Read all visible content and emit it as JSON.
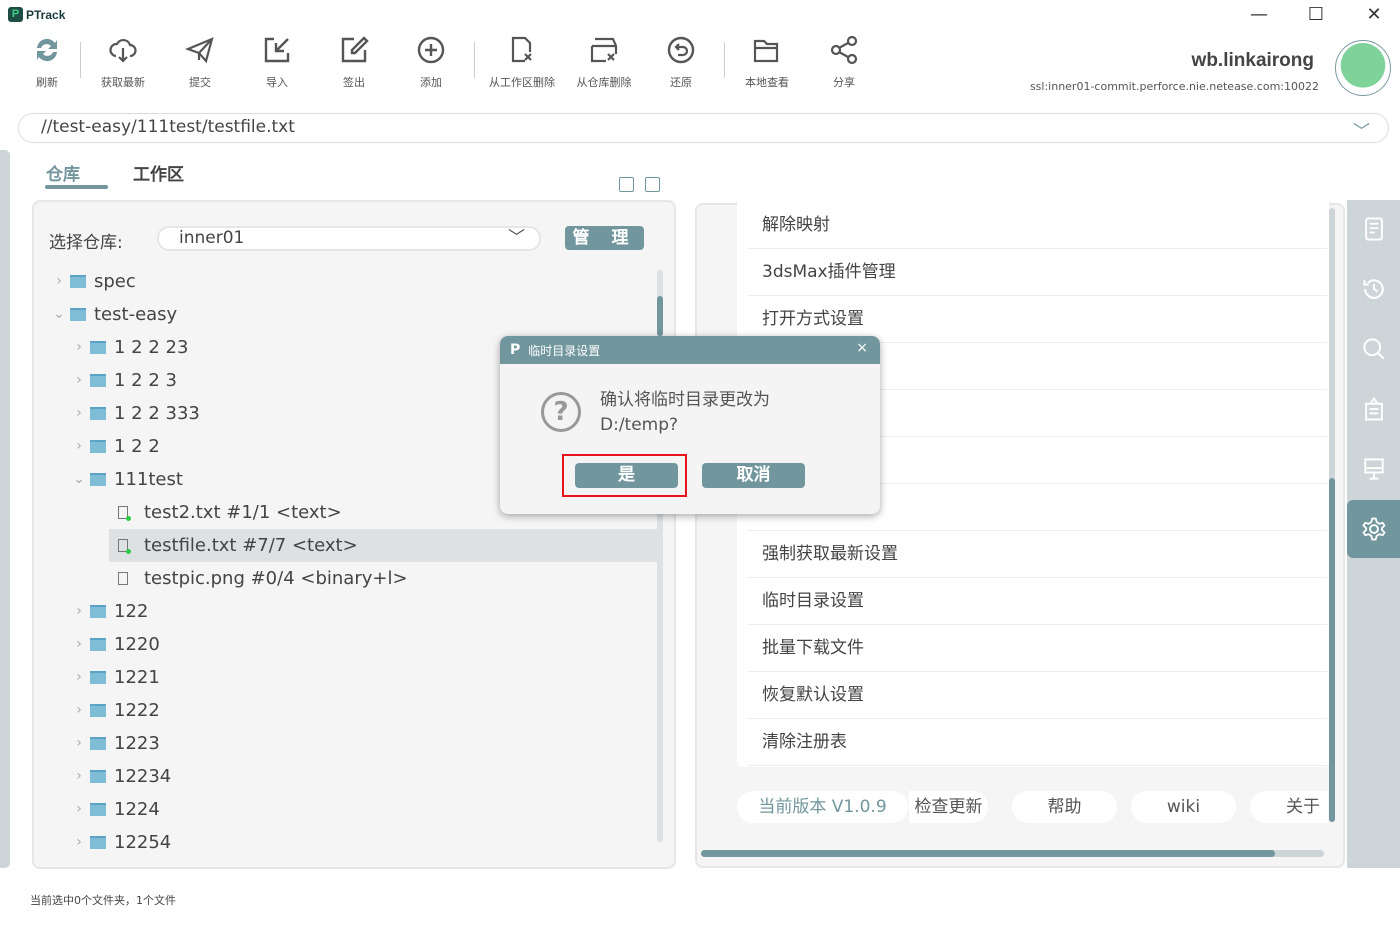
{
  "app": {
    "title": "PTrack"
  },
  "window": {
    "minimize": "—",
    "maximize": "☐",
    "close": "✕"
  },
  "toolbar": [
    {
      "label": "刷新",
      "icon": "refresh-icon"
    },
    {
      "label": "获取最新",
      "icon": "cloud-download-icon"
    },
    {
      "label": "提交",
      "icon": "send-icon"
    },
    {
      "label": "导入",
      "icon": "import-icon"
    },
    {
      "label": "签出",
      "icon": "edit-icon"
    },
    {
      "label": "添加",
      "icon": "plus-circle-icon"
    },
    {
      "label": "从工作区删除",
      "icon": "file-delete-icon"
    },
    {
      "label": "从仓库删除",
      "icon": "box-delete-icon"
    },
    {
      "label": "还原",
      "icon": "undo-icon"
    },
    {
      "label": "本地查看",
      "icon": "folder-icon"
    },
    {
      "label": "分享",
      "icon": "share-icon"
    }
  ],
  "user": {
    "name": "wb.linkairong",
    "server": "ssl:inner01-commit.perforce.nie.netease.com:10022"
  },
  "path": "//test-easy/111test/testfile.txt",
  "tabs": [
    {
      "label": "仓库",
      "active": true
    },
    {
      "label": "工作区",
      "active": false
    }
  ],
  "repo": {
    "label": "选择仓库:",
    "value": "inner01",
    "manage": "管 理"
  },
  "tree": [
    {
      "name": "spec",
      "type": "folder",
      "level": 0,
      "expanded": false
    },
    {
      "name": "test-easy",
      "type": "folder",
      "level": 0,
      "expanded": true
    },
    {
      "name": "1 2 2 23",
      "type": "folder",
      "level": 1,
      "expanded": false
    },
    {
      "name": "1 2 2 3",
      "type": "folder",
      "level": 1,
      "expanded": false
    },
    {
      "name": "1 2 2 333",
      "type": "folder",
      "level": 1,
      "expanded": false
    },
    {
      "name": "1 2 2",
      "type": "folder",
      "level": 1,
      "expanded": false
    },
    {
      "name": "111test",
      "type": "folder",
      "level": 1,
      "expanded": true
    },
    {
      "name": "test2.txt  #1/1 <text>",
      "type": "file",
      "level": 2,
      "status": "green"
    },
    {
      "name": "testfile.txt  #7/7 <text>",
      "type": "file",
      "level": 2,
      "status": "green",
      "selected": true
    },
    {
      "name": "testpic.png  #0/4 <binary+l>",
      "type": "file",
      "level": 2
    },
    {
      "name": "122",
      "type": "folder",
      "level": 1,
      "expanded": false
    },
    {
      "name": "1220",
      "type": "folder",
      "level": 1,
      "expanded": false
    },
    {
      "name": "1221",
      "type": "folder",
      "level": 1,
      "expanded": false
    },
    {
      "name": "1222",
      "type": "folder",
      "level": 1,
      "expanded": false
    },
    {
      "name": "1223",
      "type": "folder",
      "level": 1,
      "expanded": false
    },
    {
      "name": "12234",
      "type": "folder",
      "level": 1,
      "expanded": false
    },
    {
      "name": "1224",
      "type": "folder",
      "level": 1,
      "expanded": false
    },
    {
      "name": "12254",
      "type": "folder",
      "level": 1,
      "expanded": false
    }
  ],
  "settings": [
    "解除映射",
    "3dsMax插件管理",
    "打开方式设置",
    "",
    "",
    "",
    "",
    "强制获取最新设置",
    "临时目录设置",
    "批量下载文件",
    "恢复默认设置",
    "清除注册表"
  ],
  "footer": {
    "version": "当前版本 V1.0.9",
    "check": "检查更新",
    "help": "帮助",
    "wiki": "wiki",
    "about": "关于"
  },
  "sidebar": [
    "document-icon",
    "history-icon",
    "search-icon",
    "clipboard-icon",
    "monitor-icon",
    "gear-icon"
  ],
  "status": "当前选中0个文件夹，1个文件",
  "dialog": {
    "title": "临时目录设置",
    "message": "确认将临时目录更改为D:/temp?",
    "yes": "是",
    "cancel": "取消",
    "close": "×"
  },
  "colors": {
    "accent": "#72969e",
    "highlight": "#e8141c"
  }
}
